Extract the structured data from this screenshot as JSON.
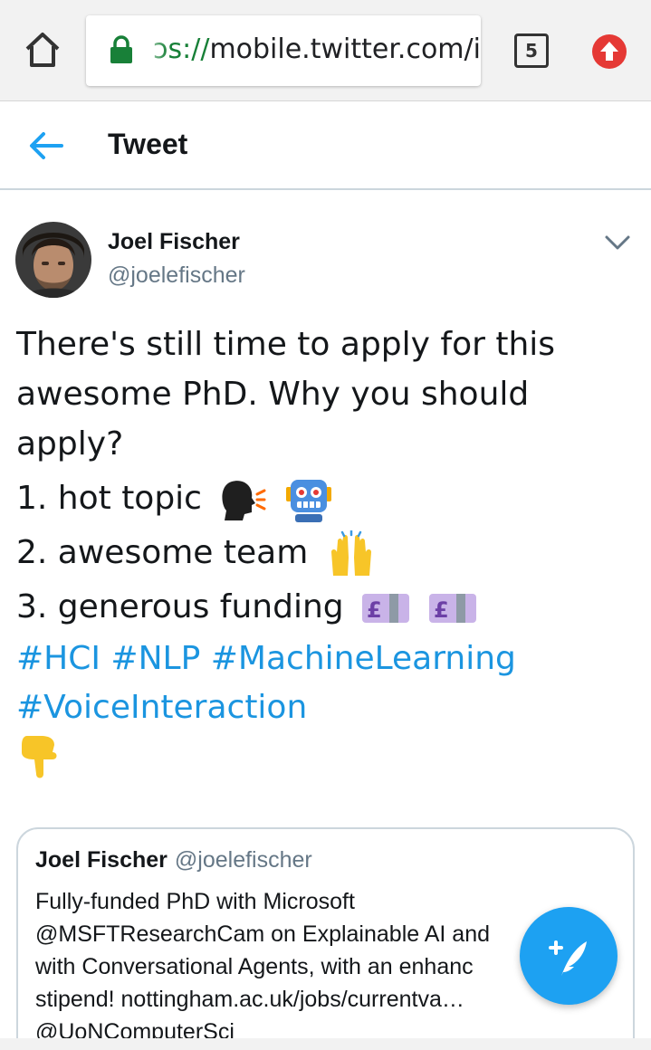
{
  "browser": {
    "url_scheme": "ɔs://",
    "url_host": "mobile.twitter.com/i",
    "tab_count": "5",
    "icons": [
      "home-icon",
      "lock-icon",
      "tabs-icon",
      "update-icon"
    ]
  },
  "header": {
    "title": "Tweet",
    "icon": "back-arrow-icon"
  },
  "tweet": {
    "author_name": "Joel Fischer",
    "author_handle": "@joelefischer",
    "lines": [
      "There's still time to apply for this",
      "awesome PhD. Why you should",
      "apply?"
    ],
    "list_items": [
      {
        "text": "1. hot topic",
        "emojis": [
          "speaking-head-emoji",
          "robot-emoji"
        ]
      },
      {
        "text": "2. awesome team",
        "emojis": [
          "raising-hands-emoji"
        ]
      },
      {
        "text": "3. generous funding",
        "emojis": [
          "pound-banknote-emoji",
          "pound-banknote-emoji"
        ]
      }
    ],
    "hashtags_line1": "#HCI #NLP #MachineLearning",
    "hashtags_line2": "#VoiceInteraction",
    "trailing_emoji": "pointing-down-emoji"
  },
  "quote": {
    "author_name": "Joel Fischer",
    "author_handle": "@joelefischer",
    "lines": [
      "Fully-funded PhD with Microsoft",
      "@MSFTResearchCam on Explainable AI and",
      "with Conversational Agents, with an enhanc",
      "stipend! nottingham.ac.uk/jobs/currentva…",
      "@UoNComputerSci"
    ]
  },
  "compose": {
    "icon": "compose-tweet-icon"
  },
  "colors": {
    "brand_blue": "#1da1f2",
    "link_blue": "#1b95e0",
    "secondary_text": "#657786",
    "lock_green": "#188038",
    "update_red": "#e53935"
  }
}
